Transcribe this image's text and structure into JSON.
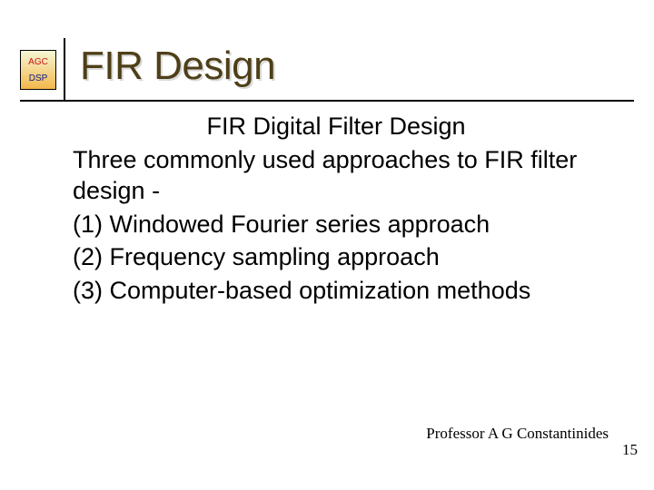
{
  "logo": {
    "agc": "AGC",
    "dsp": "DSP"
  },
  "title": "FIR Design",
  "subtitle": "FIR Digital Filter Design",
  "body": {
    "intro": "Three commonly used approaches to FIR filter design -",
    "items": [
      "(1) Windowed Fourier series approach",
      "(2) Frequency sampling approach",
      "(3) Computer-based optimization methods"
    ]
  },
  "footer": {
    "author": "Professor A G Constantinides",
    "page": "15"
  }
}
